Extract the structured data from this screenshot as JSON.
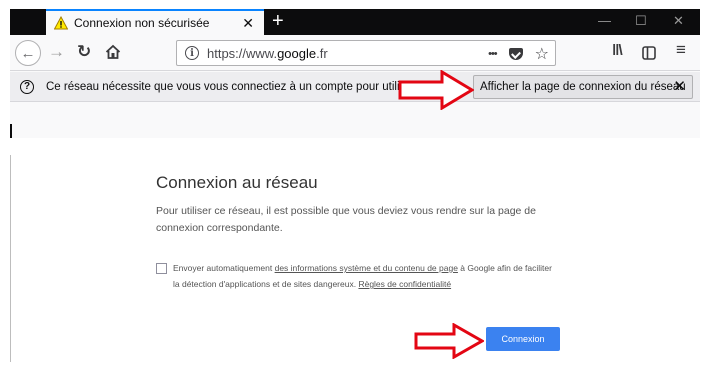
{
  "browser": {
    "tab": {
      "title": "Connexion non sécurisée",
      "icon": "warning-triangle-icon"
    },
    "toolbar": {
      "url_prefix": "https://www.",
      "url_host": "google",
      "url_suffix": ".fr",
      "page_actions_dots": "•••"
    },
    "notification": {
      "text": "Ce réseau nécessite que vous vous connectiez à un compte pour utiliser Internet.",
      "button_label": "Afficher la page de connexion du réseau"
    }
  },
  "dialog": {
    "title": "Connexion au réseau",
    "description": "Pour utiliser ce réseau, il est possible que vous deviez vous rendre sur la page de connexion correspondante.",
    "checkbox": {
      "checked": false,
      "text_before": "Envoyer automatiquement ",
      "link_info": "des informations système et du contenu de page",
      "text_middle": " à Google afin de faciliter la détection d'applications et de sites dangereux. ",
      "link_privacy": "Règles de confidentialité"
    },
    "connect_label": "Connexion"
  },
  "annotations": {
    "arrow_color": "#e30613"
  }
}
